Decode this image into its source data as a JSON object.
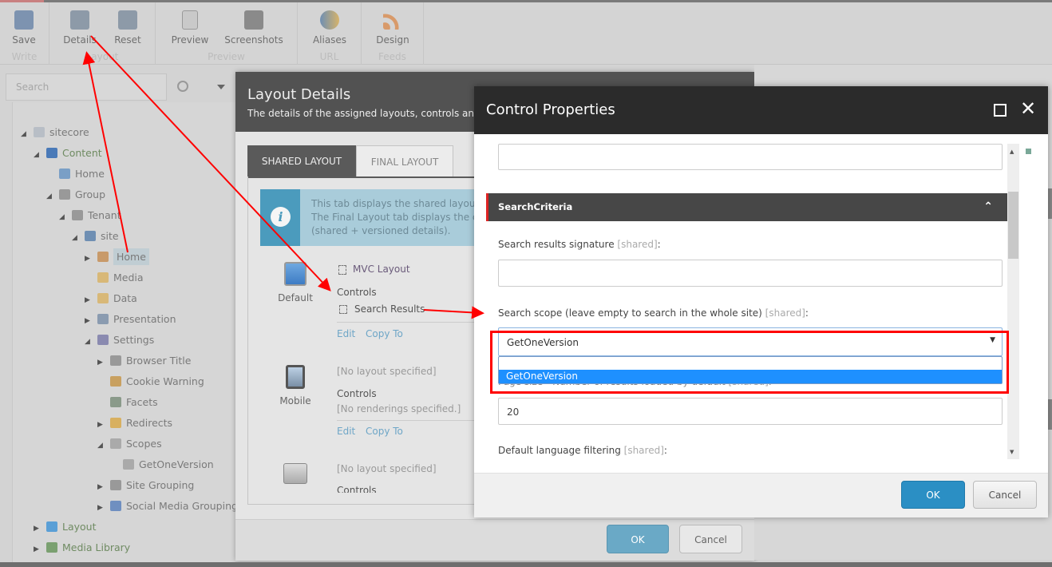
{
  "ribbon": {
    "groups": [
      {
        "label": "Write",
        "buttons": [
          {
            "label": "Save",
            "icon": "save-icon"
          }
        ]
      },
      {
        "label": "Layout",
        "buttons": [
          {
            "label": "Details",
            "icon": "details-icon"
          },
          {
            "label": "Reset",
            "icon": "reset-icon"
          }
        ]
      },
      {
        "label": "Preview",
        "buttons": [
          {
            "label": "Preview",
            "icon": "preview-icon"
          },
          {
            "label": "Screenshots",
            "icon": "camera-icon"
          }
        ]
      },
      {
        "label": "URL",
        "buttons": [
          {
            "label": "Aliases",
            "icon": "masks-icon"
          }
        ]
      },
      {
        "label": "Feeds",
        "buttons": [
          {
            "label": "Design",
            "icon": "rss-icon"
          }
        ]
      }
    ]
  },
  "search": {
    "placeholder": "Search"
  },
  "tree": [
    {
      "label": "sitecore",
      "expanded": true
    },
    {
      "label": "Content",
      "expanded": true
    },
    {
      "label": "Home"
    },
    {
      "label": "Group",
      "expanded": true
    },
    {
      "label": "Tenant",
      "expanded": true
    },
    {
      "label": "site",
      "expanded": true
    },
    {
      "label": "Home",
      "selected": true
    },
    {
      "label": "Media"
    },
    {
      "label": "Data"
    },
    {
      "label": "Presentation"
    },
    {
      "label": "Settings",
      "expanded": true
    },
    {
      "label": "Browser Title"
    },
    {
      "label": "Cookie Warning"
    },
    {
      "label": "Facets"
    },
    {
      "label": "Redirects"
    },
    {
      "label": "Scopes",
      "expanded": true
    },
    {
      "label": "GetOneVersion"
    },
    {
      "label": "Site Grouping"
    },
    {
      "label": "Social Media Grouping"
    },
    {
      "label": "Layout"
    },
    {
      "label": "Media Library"
    }
  ],
  "layout_details": {
    "title": "Layout Details",
    "subtitle": "The details of the assigned layouts, controls and pla",
    "tabs": [
      "SHARED LAYOUT",
      "FINAL LAYOUT"
    ],
    "info": [
      "This tab displays the shared layout d",
      "The Final Layout tab displays the con",
      "(shared + versioned details)."
    ],
    "devices": [
      {
        "name": "Default",
        "layout": "MVC Layout",
        "controls_label": "Controls",
        "control": "Search Results",
        "edit": "Edit",
        "copy": "Copy To"
      },
      {
        "name": "Mobile",
        "layout": "[No layout specified]",
        "controls_label": "Controls",
        "control": "[No renderings specified.]",
        "edit": "Edit",
        "copy": "Copy To"
      },
      {
        "name": "",
        "layout": "[No layout specified]",
        "controls_label": "Controls"
      }
    ],
    "ok": "OK",
    "cancel": "Cancel"
  },
  "control_properties": {
    "title": "Control Properties",
    "section": "SearchCriteria",
    "fields": {
      "signature_label": "Search results signature ",
      "signature_tag": "[shared]",
      "scope_label": "Search scope (leave empty to search in the whole site) ",
      "scope_tag": "[shared]",
      "scope_value": "GetOneVersion",
      "scope_options": [
        "",
        "GetOneVersion"
      ],
      "pagesize_label": "Page size - Number of results loaded by default ",
      "pagesize_tag": "[shared]",
      "pagesize_value": "20",
      "lang_label": "Default language filtering ",
      "lang_tag": "[shared]"
    },
    "ok": "OK",
    "cancel": "Cancel"
  },
  "colors": {
    "accent": "#2b8fc4",
    "highlight": "#1e90ff",
    "annotation": "#ff0000"
  }
}
